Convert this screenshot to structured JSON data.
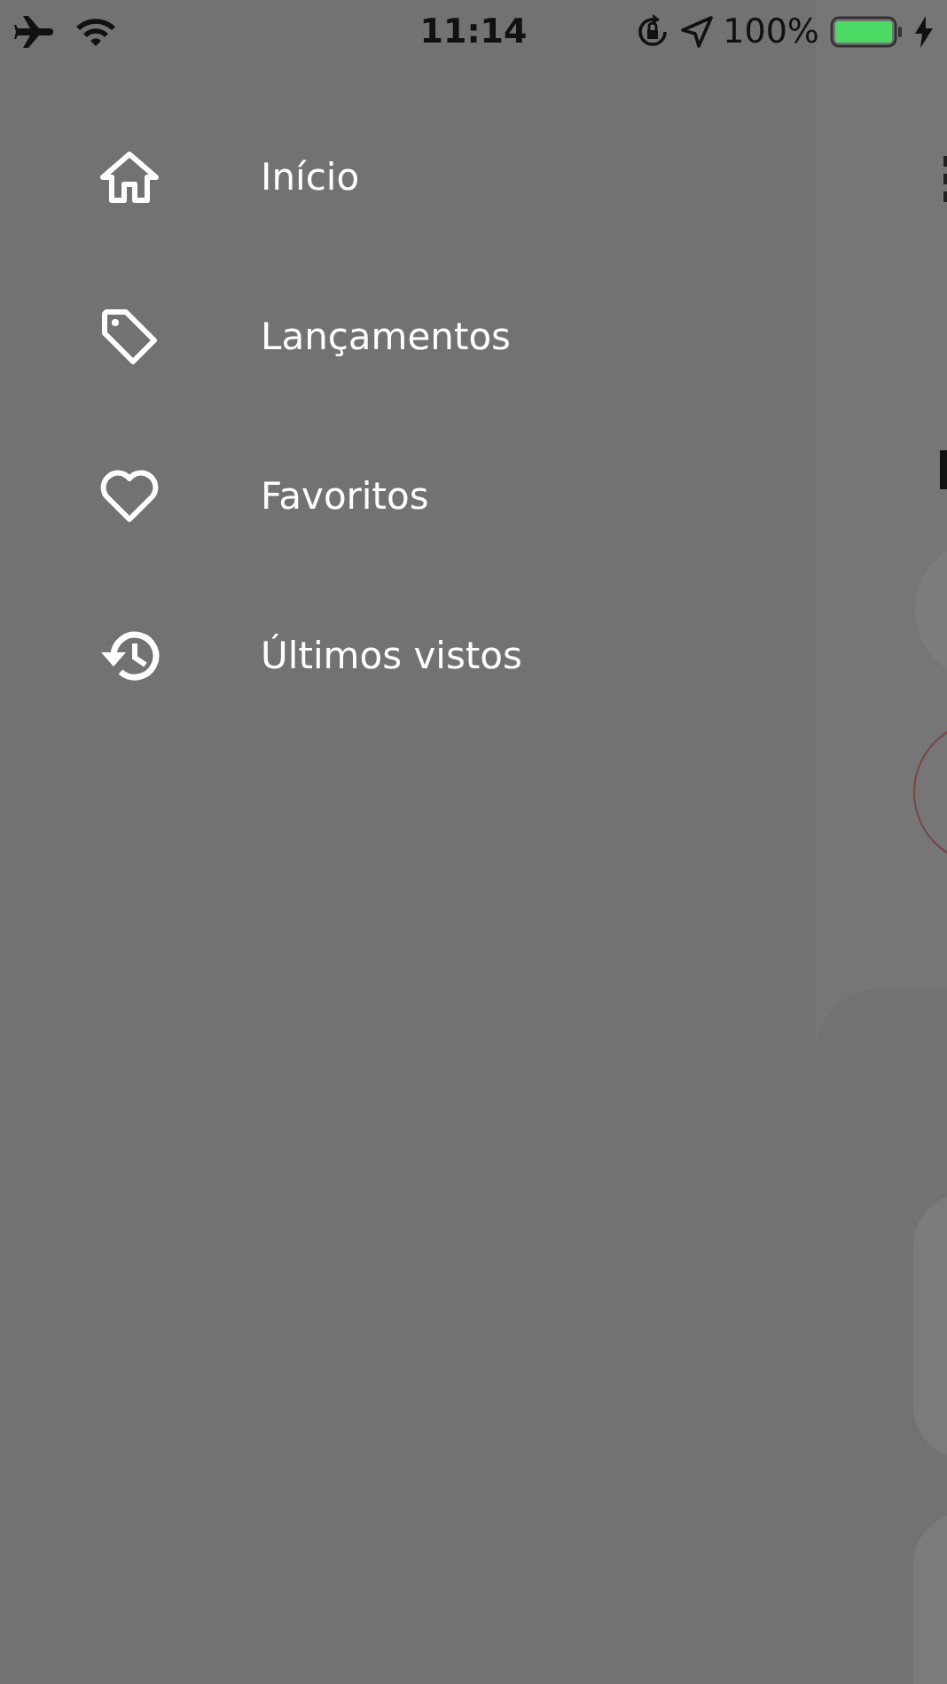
{
  "status_bar": {
    "time": "11:14",
    "battery": "100%"
  },
  "menu": [
    {
      "label": "Início",
      "kind": "home"
    },
    {
      "label": "Lançamentos",
      "kind": "tag"
    },
    {
      "label": "Favoritos",
      "kind": "heart"
    },
    {
      "label": "Últimos vistos",
      "kind": "history"
    }
  ]
}
